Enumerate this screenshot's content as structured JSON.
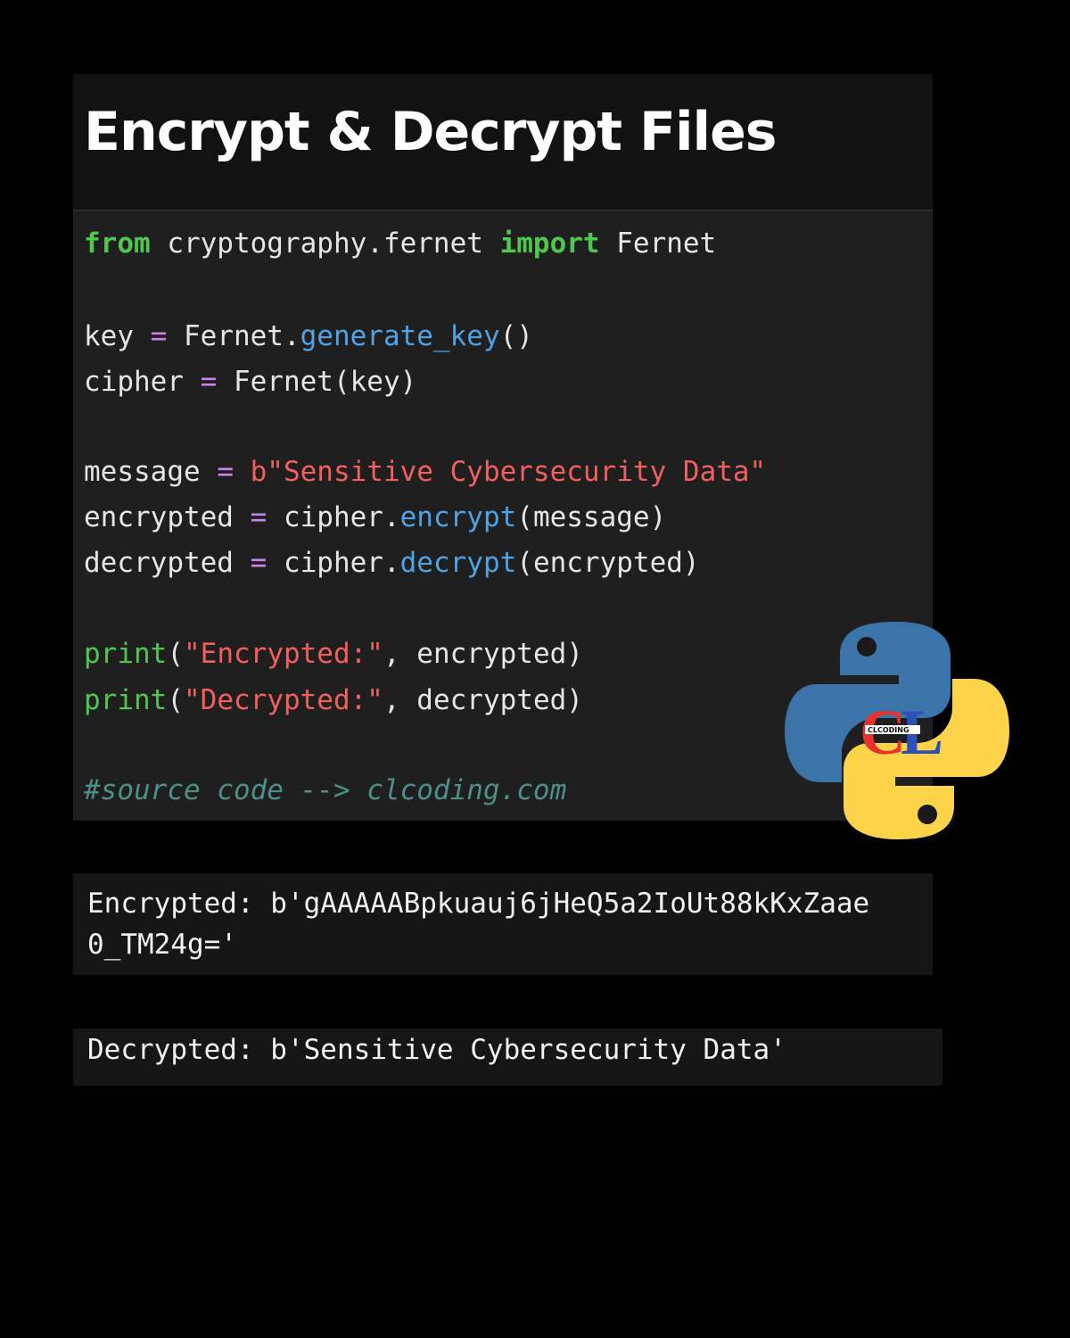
{
  "title": "Encrypt & Decrypt Files",
  "code": {
    "l1_kw1": "from",
    "l1_mod": " cryptography.fernet ",
    "l1_kw2": "import",
    "l1_name": " Fernet",
    "l3_var": "key ",
    "l3_op": "=",
    "l3_obj": " Fernet.",
    "l3_fn": "generate_key",
    "l3_end": "()",
    "l4_var": "cipher ",
    "l4_op": "=",
    "l4_rest": " Fernet(key)",
    "l6_var": "message ",
    "l6_op": "=",
    "l6_str": " b\"Sensitive Cybersecurity Data\"",
    "l7_var": "encrypted ",
    "l7_op": "=",
    "l7_obj": " cipher.",
    "l7_fn": "encrypt",
    "l7_end": "(message)",
    "l8_var": "decrypted ",
    "l8_op": "=",
    "l8_obj": " cipher.",
    "l8_fn": "decrypt",
    "l8_end": "(encrypted)",
    "l10_pr": "print",
    "l10_open": "(",
    "l10_str": "\"Encrypted:\"",
    "l10_end": ", encrypted)",
    "l11_pr": "print",
    "l11_open": "(",
    "l11_str": "\"Decrypted:\"",
    "l11_end": ", decrypted)",
    "comment": "#source code --> clcoding.com"
  },
  "output": {
    "encrypted_line1": "Encrypted: b'gAAAAABpkuauj6jHeQ5a2IoUt88kKxZaae",
    "encrypted_line2": "0_TM24g='",
    "decrypted": "Decrypted: b'Sensitive Cybersecurity Data'"
  },
  "logo": {
    "text": "CL",
    "subtext": "CLCODING",
    "colors": {
      "blue": "#3a74a8",
      "yellow": "#fdd34a",
      "red": "#e8322c",
      "letter_blue": "#2e4fb8"
    }
  },
  "colors": {
    "background": "#000000",
    "panel": "#1f1f1f",
    "keyword": "#4ec94e",
    "function": "#4ea3e6",
    "operator": "#c586e8",
    "string": "#f25f5c",
    "comment": "#4d8f8a"
  }
}
